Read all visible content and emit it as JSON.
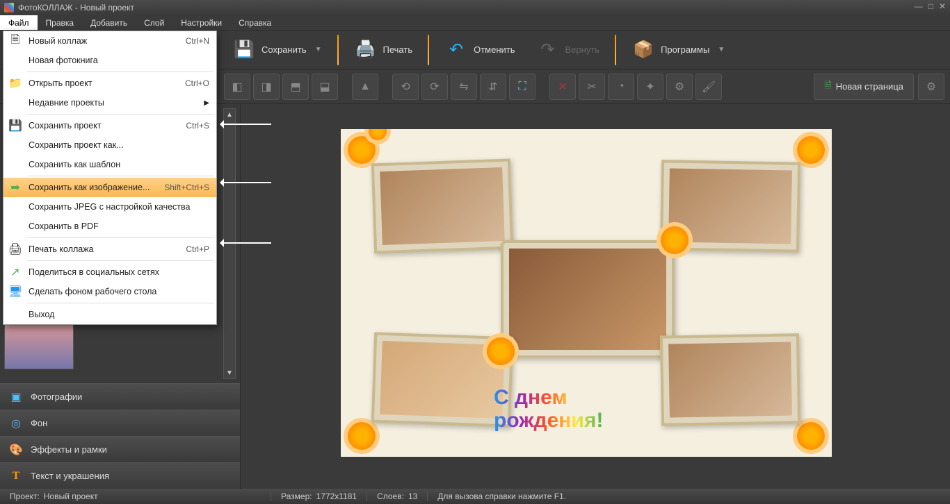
{
  "title": "ФотоКОЛЛАЖ - Новый проект",
  "menus": {
    "file": "Файл",
    "edit": "Правка",
    "add": "Добавить",
    "layer": "Слой",
    "settings": "Настройки",
    "help": "Справка"
  },
  "toolbar": {
    "save": "Сохранить",
    "print": "Печать",
    "undo": "Отменить",
    "redo": "Вернуть",
    "programs": "Программы"
  },
  "newpage_btn": "Новая страница",
  "file_menu": {
    "new_collage": {
      "label": "Новый коллаж",
      "sc": "Ctrl+N"
    },
    "new_photobook": {
      "label": "Новая фотокнига"
    },
    "open_project": {
      "label": "Открыть проект",
      "sc": "Ctrl+O"
    },
    "recent": {
      "label": "Недавние проекты"
    },
    "save_project": {
      "label": "Сохранить проект",
      "sc": "Ctrl+S"
    },
    "save_project_as": {
      "label": "Сохранить проект как..."
    },
    "save_as_template": {
      "label": "Сохранить как шаблон"
    },
    "save_as_image": {
      "label": "Сохранить как изображение...",
      "sc": "Shift+Ctrl+S"
    },
    "save_jpeg": {
      "label": "Сохранить JPEG с настройкой качества"
    },
    "save_pdf": {
      "label": "Сохранить в PDF"
    },
    "print_collage": {
      "label": "Печать коллажа",
      "sc": "Ctrl+P"
    },
    "share": {
      "label": "Поделиться в социальных сетях"
    },
    "set_wallpaper": {
      "label": "Сделать фоном рабочего стола"
    },
    "exit": {
      "label": "Выход"
    }
  },
  "accordion": {
    "photos": "Фотографии",
    "background": "Фон",
    "effects": "Эффекты и рамки",
    "text": "Текст и украшения"
  },
  "status": {
    "project_lbl": "Проект:",
    "project_val": "Новый проект",
    "size_lbl": "Размер:",
    "size_val": "1772x1181",
    "layers_lbl": "Слоев:",
    "layers_val": "13",
    "help": "Для вызова справки нажмите F1."
  },
  "collage_text": {
    "line1": "С днем",
    "line2": "рождения!"
  }
}
